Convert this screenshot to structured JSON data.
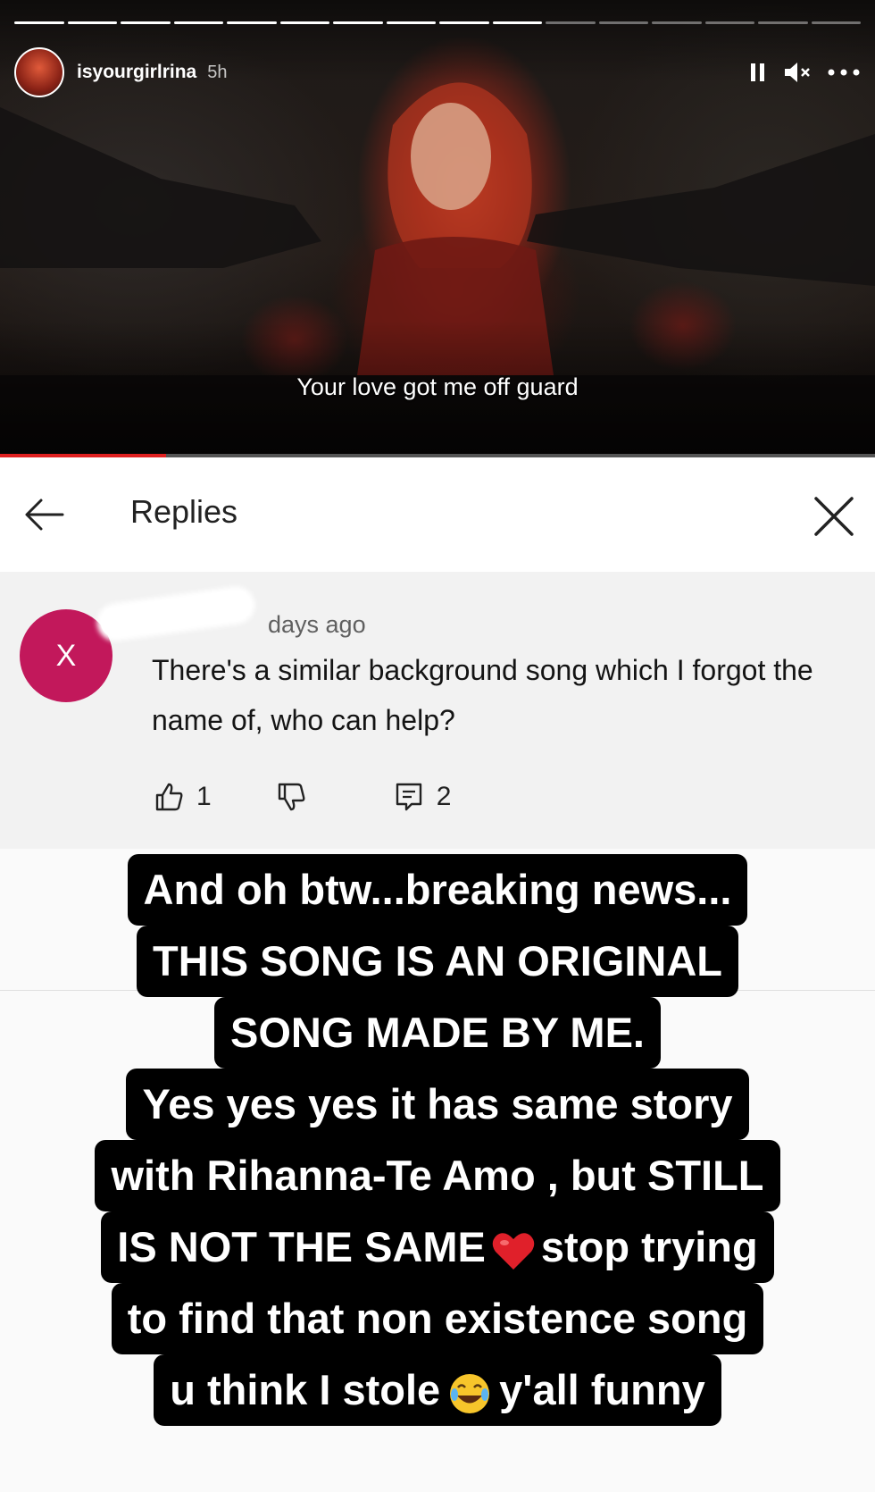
{
  "story": {
    "username": "isyourgirlrina",
    "time_ago": "5h",
    "subtitle": "Your love got me off guard",
    "progress_segments": 16,
    "progress_completed": 10,
    "video_progress": 0.19
  },
  "replies_panel": {
    "title": "Replies"
  },
  "comment": {
    "avatar_letter": "X",
    "time_ago": "days ago",
    "text": "There's a similar background song which I forgot the name of, who can help?",
    "likes": "1",
    "replies": "2"
  },
  "caption": {
    "lines": [
      "And oh btw...breaking news...",
      "THIS SONG IS AN ORIGINAL",
      "SONG MADE BY ME.",
      "Yes yes yes it has same story",
      "with Rihanna-Te Amo , but STILL",
      "IS NOT THE SAME",
      "stop trying",
      "to find that non existence song",
      "u think I stole",
      "y'all funny"
    ]
  },
  "colors": {
    "comment_avatar": "#c2185b",
    "player_progress": "#e02020",
    "caption_bg": "#000000"
  },
  "icons": [
    "pause-icon",
    "mute-icon",
    "more-icon",
    "back-arrow-icon",
    "close-icon",
    "thumbs-up-icon",
    "thumbs-down-icon",
    "reply-icon",
    "red-heart-emoji",
    "laughing-emoji"
  ]
}
